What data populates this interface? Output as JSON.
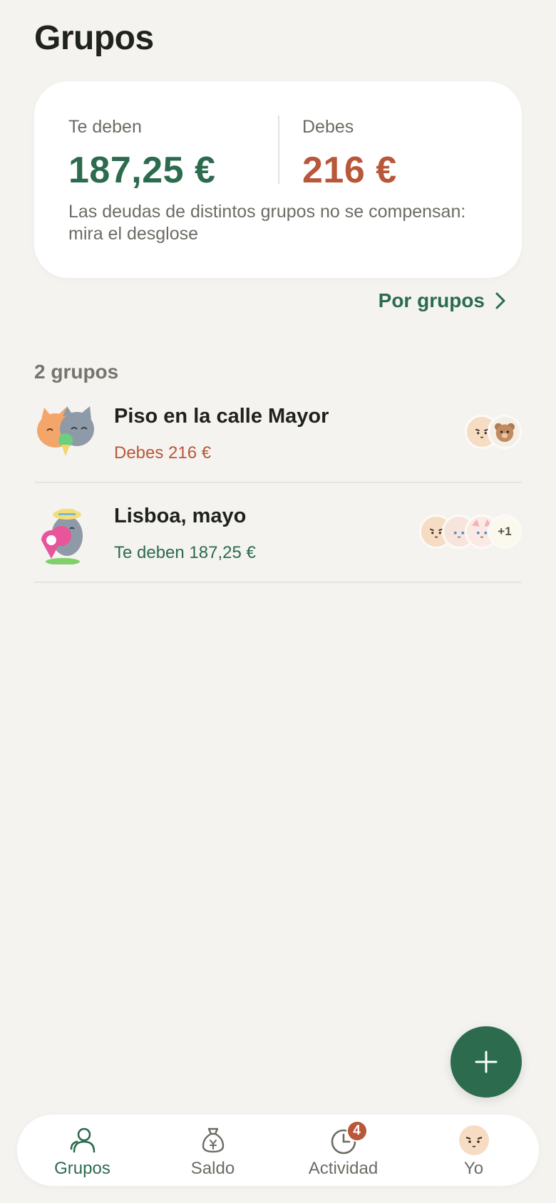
{
  "header": {
    "title": "Grupos"
  },
  "summary": {
    "owed_to_you_label": "Te deben",
    "owed_to_you_amount": "187,25 €",
    "you_owe_label": "Debes",
    "you_owe_amount": "216 €",
    "note": "Las deudas de distintos grupos no se compensan: mira el desglose"
  },
  "by_groups_link": {
    "label": "Por grupos",
    "icon": "chevron-right-icon"
  },
  "groups_count_label": "2 grupos",
  "groups": [
    {
      "name": "Piso en la calle Mayor",
      "balance": "Debes 216 €",
      "balance_color": "#b8573a",
      "avatar_icon": "cats-hugging-icon",
      "members": [
        "cat-face-icon",
        "bear-face-icon"
      ]
    },
    {
      "name": "Lisboa, mayo",
      "balance": "Te deben 187,25 €",
      "balance_color": "#2c6b4e",
      "avatar_icon": "cat-map-pin-icon",
      "members": [
        "cat-face-icon",
        "white-cat-face-icon",
        "white-cat-face-icon"
      ],
      "more_members": "+1"
    }
  ],
  "fab": {
    "icon": "plus-icon"
  },
  "tabbar": {
    "items": [
      {
        "label": "Grupos",
        "icon": "users-icon",
        "active": true
      },
      {
        "label": "Saldo",
        "icon": "money-bag-icon",
        "active": false
      },
      {
        "label": "Actividad",
        "icon": "clock-icon",
        "active": false,
        "badge": "4"
      },
      {
        "label": "Yo",
        "icon": "profile-avatar",
        "active": false
      }
    ]
  },
  "colors": {
    "background": "#f4f3f0",
    "accent_green": "#2c6b4e",
    "accent_red": "#b8573a"
  }
}
